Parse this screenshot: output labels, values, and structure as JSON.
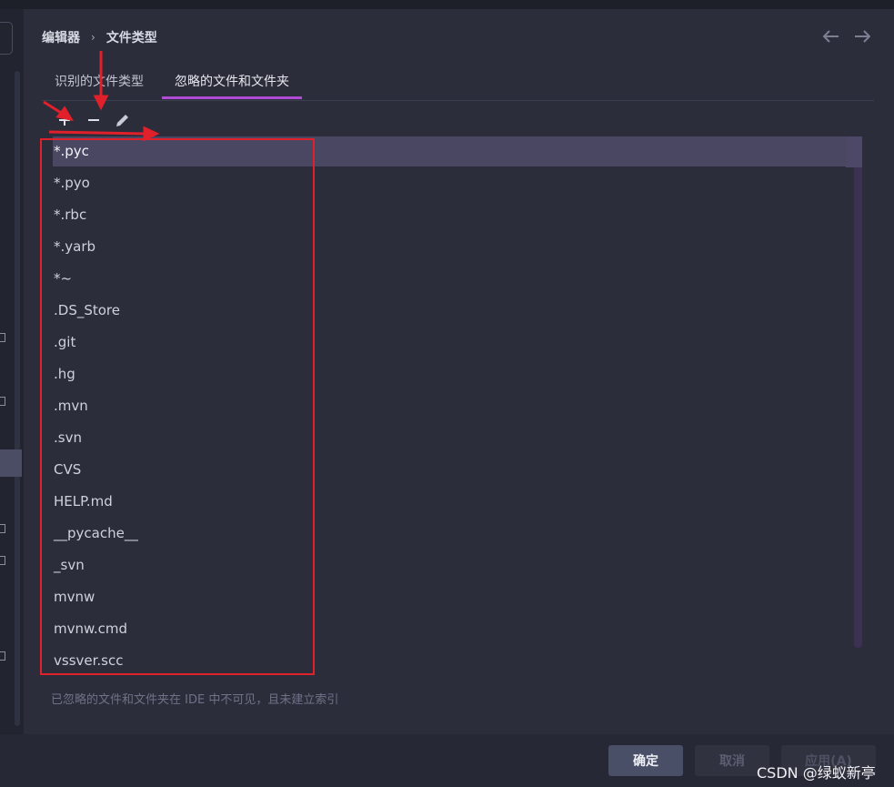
{
  "breadcrumb": {
    "parent": "编辑器",
    "separator": "›",
    "current": "文件类型"
  },
  "nav": {
    "back_icon": "arrow-left-icon",
    "forward_icon": "arrow-right-icon"
  },
  "tabs": [
    {
      "label": "识别的文件类型",
      "active": false
    },
    {
      "label": "忽略的文件和文件夹",
      "active": true
    }
  ],
  "toolbar": {
    "add_icon": "plus-icon",
    "remove_icon": "minus-icon",
    "edit_icon": "pencil-icon"
  },
  "ignored_items": [
    "*.pyc",
    "*.pyo",
    "*.rbc",
    "*.yarb",
    "*~",
    ".DS_Store",
    ".git",
    ".hg",
    ".mvn",
    ".svn",
    "CVS",
    "HELP.md",
    "__pycache__",
    "_svn",
    "mvnw",
    "mvnw.cmd",
    "vssver.scc"
  ],
  "selected_index": 0,
  "hint": "已忽略的文件和文件夹在 IDE 中不可见，且未建立索引",
  "buttons": {
    "ok": "确定",
    "cancel": "取消",
    "apply": "应用(A)"
  },
  "watermark": "CSDN @绿蚁新亭",
  "colors": {
    "accent": "#b04bd6",
    "annotation": "#e0202a",
    "selection": "#4a4763"
  }
}
